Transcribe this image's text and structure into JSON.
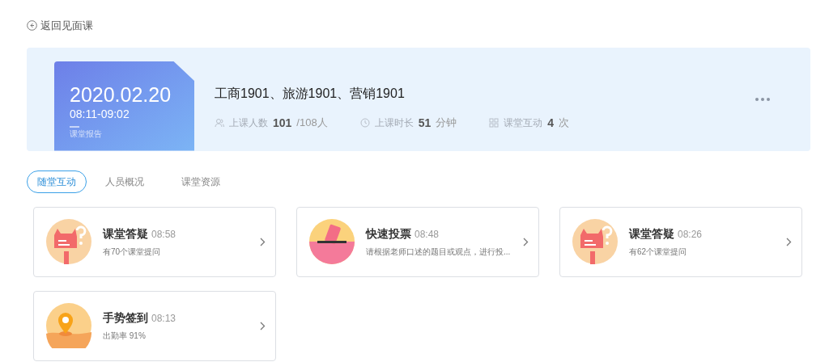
{
  "back_link": "返回见面课",
  "lesson": {
    "date": "2020.02.20",
    "time": "08:11-09:02",
    "report": "课堂报告",
    "classes": "工商1901、旅游1901、营销1901",
    "stats": [
      {
        "kind": "people",
        "label": "上课人数",
        "value": "101",
        "unit": "/108人"
      },
      {
        "kind": "clock",
        "label": "上课时长",
        "value": "51",
        "unit": "分钟"
      },
      {
        "kind": "interact",
        "label": "课堂互动",
        "value": "4",
        "unit": "次"
      }
    ]
  },
  "tabs": [
    {
      "label": "随堂互动",
      "selected": true
    },
    {
      "label": "人员概况",
      "selected": false
    },
    {
      "label": "课堂资源",
      "selected": false
    }
  ],
  "activities": [
    {
      "kind": "qa",
      "title": "课堂答疑",
      "time": "08:58",
      "desc": "有70个课堂提问"
    },
    {
      "kind": "vote",
      "title": "快速投票",
      "time": "08:48",
      "desc": "请根据老师口述的题目或观点，进行投..."
    },
    {
      "kind": "qa",
      "title": "课堂答疑",
      "time": "08:26",
      "desc": "有62个课堂提问"
    },
    {
      "kind": "checkin",
      "title": "手势签到",
      "time": "08:13",
      "desc": "出勤率 91%"
    }
  ]
}
